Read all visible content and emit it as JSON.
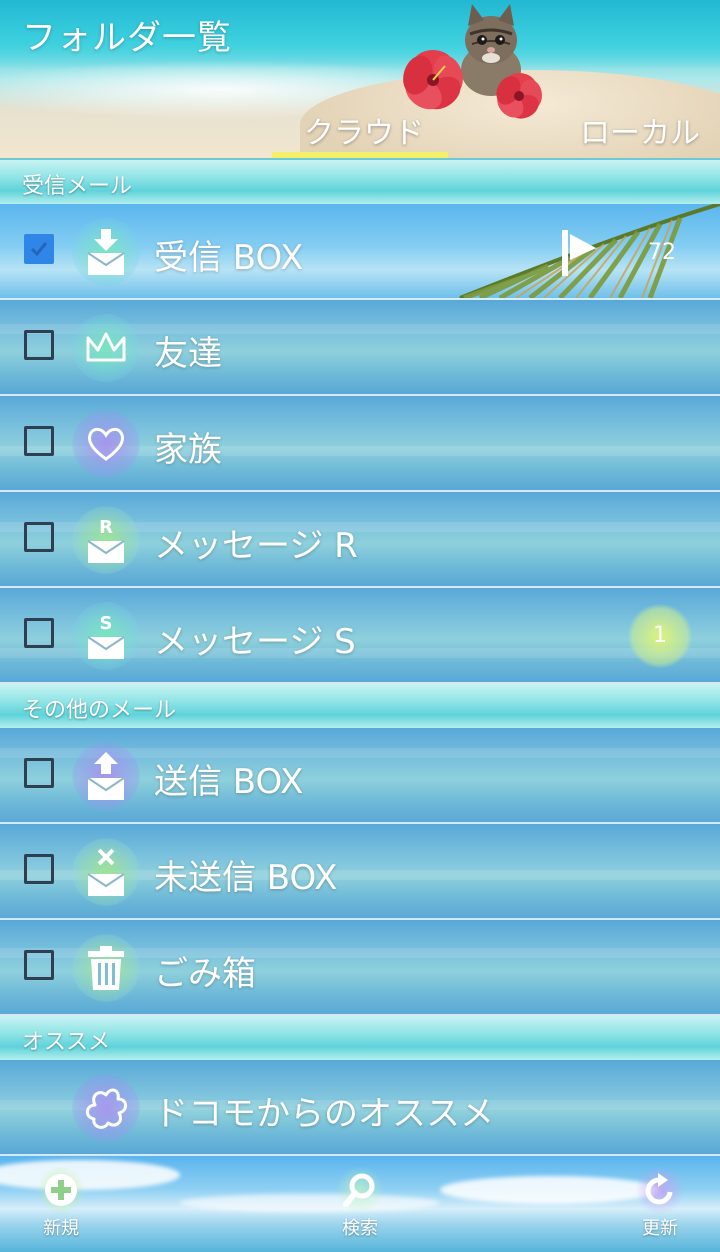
{
  "header": {
    "title": "フォルダ一覧",
    "tabs": [
      {
        "label": "クラウド",
        "selected": true
      },
      {
        "label": "ローカル",
        "selected": false
      }
    ]
  },
  "sections": [
    {
      "title": "受信メール",
      "folders": [
        {
          "label": "受信 BOX",
          "icon": "inbox-download-icon",
          "checked": true,
          "count": "72",
          "flag": true
        },
        {
          "label": "友達",
          "icon": "crown-icon",
          "checked": false
        },
        {
          "label": "家族",
          "icon": "heart-icon",
          "checked": false
        },
        {
          "label": "メッセージ R",
          "icon": "message-r-icon",
          "checked": false
        },
        {
          "label": "メッセージ S",
          "icon": "message-s-icon",
          "checked": false,
          "badge": "1"
        }
      ]
    },
    {
      "title": "その他のメール",
      "folders": [
        {
          "label": "送信 BOX",
          "icon": "outbox-upload-icon",
          "checked": false
        },
        {
          "label": "未送信 BOX",
          "icon": "unsent-x-icon",
          "checked": false
        },
        {
          "label": "ごみ箱",
          "icon": "trash-icon",
          "checked": false
        }
      ]
    },
    {
      "title": "オススメ",
      "folders": [
        {
          "label": "ドコモからのオススメ",
          "icon": "flower-icon"
        }
      ]
    }
  ],
  "bottom_bar": {
    "new_label": "新規",
    "search_label": "検索",
    "refresh_label": "更新"
  },
  "colors": {
    "tab_underline": "#f5f06a",
    "checkbox_checked": "#2f86e6"
  }
}
